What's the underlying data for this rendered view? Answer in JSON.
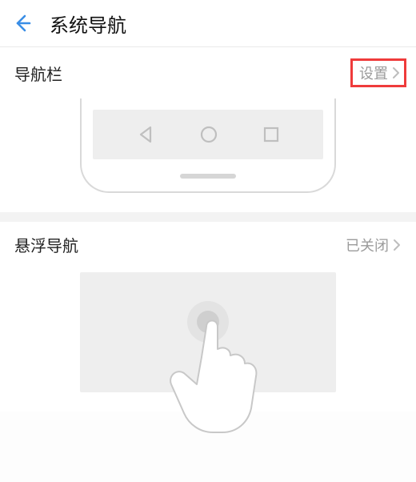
{
  "header": {
    "title": "系统导航"
  },
  "nav_section": {
    "label": "导航栏",
    "value": "设置"
  },
  "float_section": {
    "label": "悬浮导航",
    "value": "已关闭"
  }
}
